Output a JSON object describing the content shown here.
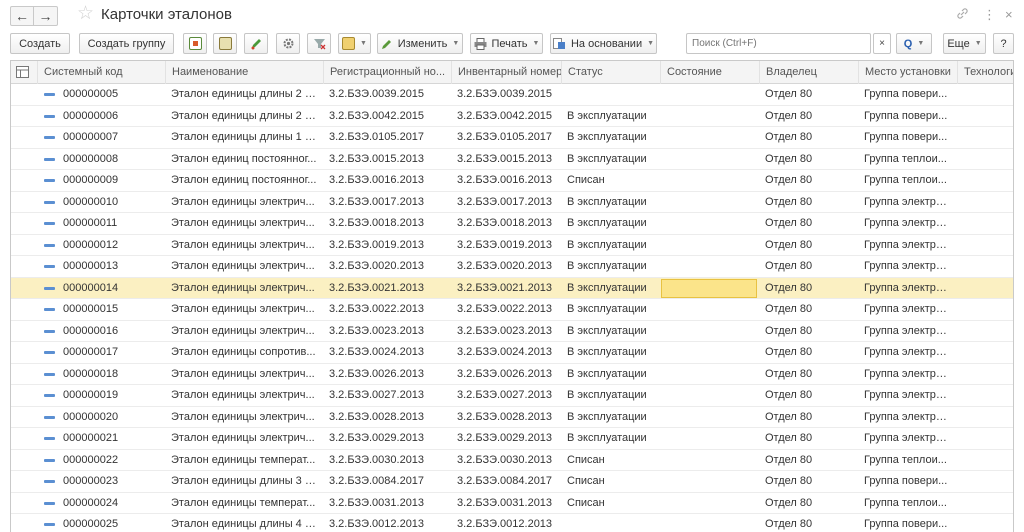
{
  "window": {
    "title": "Карточки эталонов"
  },
  "toolbar": {
    "create": "Создать",
    "create_group": "Создать группу",
    "edit": "Изменить",
    "print": "Печать",
    "based_on": "На основании",
    "search_placeholder": "Поиск (Ctrl+F)",
    "clear": "×",
    "search_btn": "Q",
    "more": "Еще",
    "help": "?"
  },
  "icons": {
    "back": "←",
    "forward": "→",
    "star": "☆",
    "link": "🔗",
    "more": "⋮",
    "close": "×"
  },
  "columns": [
    "Системный код",
    "Наименование",
    "Регистрационный но...",
    "Инвентарный номер",
    "Статус",
    "Состояние",
    "Владелец",
    "Место установки",
    "Технологич..."
  ],
  "rows": [
    {
      "code": "000000005",
      "name": "Эталон единицы длины 2 р...",
      "reg": "3.2.БЗЭ.0039.2015",
      "inv": "3.2.БЗЭ.0039.2015",
      "status": "",
      "owner": "Отдел 80",
      "place": "Группа повери..."
    },
    {
      "code": "000000006",
      "name": "Эталон единицы длины 2 р...",
      "reg": "3.2.БЗЭ.0042.2015",
      "inv": "3.2.БЗЭ.0042.2015",
      "status": "В эксплуатации",
      "owner": "Отдел 80",
      "place": "Группа повери..."
    },
    {
      "code": "000000007",
      "name": "Эталон единицы длины 1 р...",
      "reg": "3.2.БЗЭ.0105.2017",
      "inv": "3.2.БЗЭ.0105.2017",
      "status": "В эксплуатации",
      "owner": "Отдел 80",
      "place": "Группа повери..."
    },
    {
      "code": "000000008",
      "name": "Эталон единиц постоянног...",
      "reg": "3.2.БЗЭ.0015.2013",
      "inv": "3.2.БЗЭ.0015.2013",
      "status": "В эксплуатации",
      "owner": "Отдел 80",
      "place": "Группа теплои..."
    },
    {
      "code": "000000009",
      "name": "Эталон единиц постоянног...",
      "reg": "3.2.БЗЭ.0016.2013",
      "inv": "3.2.БЗЭ.0016.2013",
      "status": "Списан",
      "owner": "Отдел 80",
      "place": "Группа теплои..."
    },
    {
      "code": "000000010",
      "name": "Эталон единицы электрич...",
      "reg": "3.2.БЗЭ.0017.2013",
      "inv": "3.2.БЗЭ.0017.2013",
      "status": "В эксплуатации",
      "owner": "Отдел 80",
      "place": "Группа электро..."
    },
    {
      "code": "000000011",
      "name": "Эталон единицы электрич...",
      "reg": "3.2.БЗЭ.0018.2013",
      "inv": "3.2.БЗЭ.0018.2013",
      "status": "В эксплуатации",
      "owner": "Отдел 80",
      "place": "Группа электро..."
    },
    {
      "code": "000000012",
      "name": "Эталон единицы электрич...",
      "reg": "3.2.БЗЭ.0019.2013",
      "inv": "3.2.БЗЭ.0019.2013",
      "status": "В эксплуатации",
      "owner": "Отдел 80",
      "place": "Группа электро..."
    },
    {
      "code": "000000013",
      "name": "Эталон единицы электрич...",
      "reg": "3.2.БЗЭ.0020.2013",
      "inv": "3.2.БЗЭ.0020.2013",
      "status": "В эксплуатации",
      "owner": "Отдел 80",
      "place": "Группа электро..."
    },
    {
      "code": "000000014",
      "name": "Эталон единицы электрич...",
      "reg": "3.2.БЗЭ.0021.2013",
      "inv": "3.2.БЗЭ.0021.2013",
      "status": "В эксплуатации",
      "owner": "Отдел 80",
      "place": "Группа электро...",
      "selected": true
    },
    {
      "code": "000000015",
      "name": "Эталон единицы электрич...",
      "reg": "3.2.БЗЭ.0022.2013",
      "inv": "3.2.БЗЭ.0022.2013",
      "status": "В эксплуатации",
      "owner": "Отдел 80",
      "place": "Группа электро..."
    },
    {
      "code": "000000016",
      "name": "Эталон единицы электрич...",
      "reg": "3.2.БЗЭ.0023.2013",
      "inv": "3.2.БЗЭ.0023.2013",
      "status": "В эксплуатации",
      "owner": "Отдел 80",
      "place": "Группа электро..."
    },
    {
      "code": "000000017",
      "name": "Эталон единицы сопротив...",
      "reg": "3.2.БЗЭ.0024.2013",
      "inv": "3.2.БЗЭ.0024.2013",
      "status": "В эксплуатации",
      "owner": "Отдел 80",
      "place": "Группа электро..."
    },
    {
      "code": "000000018",
      "name": "Эталон единицы электрич...",
      "reg": "3.2.БЗЭ.0026.2013",
      "inv": "3.2.БЗЭ.0026.2013",
      "status": "В эксплуатации",
      "owner": "Отдел 80",
      "place": "Группа электро..."
    },
    {
      "code": "000000019",
      "name": "Эталон единицы электрич...",
      "reg": "3.2.БЗЭ.0027.2013",
      "inv": "3.2.БЗЭ.0027.2013",
      "status": "В эксплуатации",
      "owner": "Отдел 80",
      "place": "Группа электро..."
    },
    {
      "code": "000000020",
      "name": "Эталон единицы электрич...",
      "reg": "3.2.БЗЭ.0028.2013",
      "inv": "3.2.БЗЭ.0028.2013",
      "status": "В эксплуатации",
      "owner": "Отдел 80",
      "place": "Группа электро..."
    },
    {
      "code": "000000021",
      "name": "Эталон единицы электрич...",
      "reg": "3.2.БЗЭ.0029.2013",
      "inv": "3.2.БЗЭ.0029.2013",
      "status": "В эксплуатации",
      "owner": "Отдел 80",
      "place": "Группа электро..."
    },
    {
      "code": "000000022",
      "name": "Эталон единицы температ...",
      "reg": "3.2.БЗЭ.0030.2013",
      "inv": "3.2.БЗЭ.0030.2013",
      "status": "Списан",
      "owner": "Отдел 80",
      "place": "Группа теплои..."
    },
    {
      "code": "000000023",
      "name": "Эталон единицы длины 3 р...",
      "reg": "3.2.БЗЭ.0084.2017",
      "inv": "3.2.БЗЭ.0084.2017",
      "status": "Списан",
      "owner": "Отдел 80",
      "place": "Группа повери..."
    },
    {
      "code": "000000024",
      "name": "Эталон единицы температ...",
      "reg": "3.2.БЗЭ.0031.2013",
      "inv": "3.2.БЗЭ.0031.2013",
      "status": "Списан",
      "owner": "Отдел 80",
      "place": "Группа теплои..."
    },
    {
      "code": "000000025",
      "name": "Эталон единицы длины 4 р...",
      "reg": "3.2.БЗЭ.0012.2013",
      "inv": "3.2.БЗЭ.0012.2013",
      "status": "",
      "owner": "Отдел 80",
      "place": "Группа повери..."
    }
  ]
}
